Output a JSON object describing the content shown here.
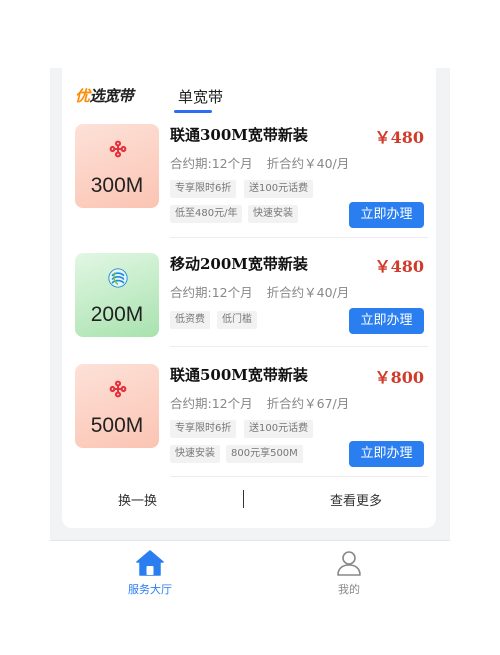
{
  "header": {
    "brand_accent": "优",
    "brand_rest": "选宽带",
    "tab_label": "单宽带"
  },
  "products": [
    {
      "speed": "300M",
      "title": "联通300M宽带新装",
      "price": "￥480",
      "contract": "合约期:12个月",
      "monthly": "折合约￥40/月",
      "tags": [
        "专享限时6折",
        "送100元话费",
        "低至480元/年",
        "快速安装"
      ],
      "button": "立即办理",
      "logo": "china-unicom-logo",
      "color": "#fbc4b3"
    },
    {
      "speed": "200M",
      "title": "移动200M宽带新装",
      "price": "￥480",
      "contract": "合约期:12个月",
      "monthly": "折合约￥40/月",
      "tags": [
        "低资费",
        "低门槛"
      ],
      "button": "立即办理",
      "logo": "china-mobile-logo",
      "color": "#a8e2ae"
    },
    {
      "speed": "500M",
      "title": "联通500M宽带新装",
      "price": "￥800",
      "contract": "合约期:12个月",
      "monthly": "折合约￥67/月",
      "tags": [
        "专享限时6折",
        "送100元话费",
        "快速安装",
        "800元享500M"
      ],
      "button": "立即办理",
      "logo": "china-unicom-logo",
      "color": "#fbc4b3"
    }
  ],
  "footer": {
    "refresh": "换一换",
    "more": "查看更多"
  },
  "nav": {
    "service": "服务大厅",
    "mine": "我的",
    "active_color": "#2a7ef0"
  }
}
